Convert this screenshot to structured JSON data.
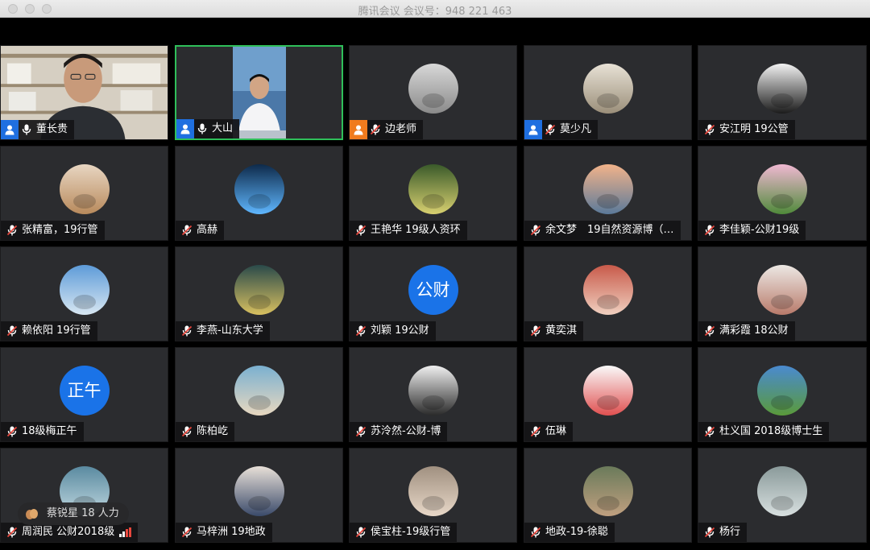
{
  "window": {
    "title": "腾讯会议 会议号：948 221 463"
  },
  "colors": {
    "tile_bg": "#2b2c2f",
    "active_border": "#2fbf5a",
    "host_badge": "#1f6fe0",
    "host_badge_orange": "#f07b1e",
    "avatar_text_bg": "#1a73e8",
    "mute_red": "#e9473d"
  },
  "participants": [
    {
      "name": "董长贵",
      "host": "blue",
      "mic": "on",
      "type": "video-bookshelf"
    },
    {
      "name": "大山",
      "host": "blue",
      "mic": "on",
      "type": "video-speaker",
      "active": true
    },
    {
      "name": "边老师",
      "host": "orange",
      "mic": "muted",
      "type": "avatar",
      "avatar": "road-photo"
    },
    {
      "name": "莫少凡",
      "host": "blue",
      "mic": "muted",
      "type": "avatar",
      "avatar": "wall-photo"
    },
    {
      "name": "安江明 19公管",
      "mic": "muted",
      "type": "avatar",
      "avatar": "hooded-photo"
    },
    {
      "name": "张精富，19行管",
      "mic": "muted",
      "type": "avatar",
      "avatar": "cat-photo"
    },
    {
      "name": "高赫",
      "mic": "muted",
      "type": "avatar",
      "avatar": "energy-photo"
    },
    {
      "name": "王艳华 19级人资环",
      "mic": "muted",
      "type": "avatar",
      "avatar": "tree-photo"
    },
    {
      "name": "余文梦　19自然资源博（…",
      "mic": "muted",
      "type": "avatar",
      "avatar": "sunset-lake-photo"
    },
    {
      "name": "李佳颖-公财19级",
      "mic": "muted",
      "type": "avatar",
      "avatar": "blossom-photo"
    },
    {
      "name": "赖依阳 19行管",
      "mic": "muted",
      "type": "avatar",
      "avatar": "sky-photo"
    },
    {
      "name": "李燕-山东大学",
      "mic": "muted",
      "type": "avatar",
      "avatar": "illustration-photo"
    },
    {
      "name": "刘颖 19公财",
      "mic": "muted",
      "type": "avatar-text",
      "avatar_text": "公财"
    },
    {
      "name": "黄奕淇",
      "mic": "muted",
      "type": "avatar",
      "avatar": "church-photo"
    },
    {
      "name": "满彩霞 18公财",
      "mic": "muted",
      "type": "avatar",
      "avatar": "building-photo"
    },
    {
      "name": "18级梅正午",
      "mic": "muted",
      "type": "avatar-text",
      "avatar_text": "正午"
    },
    {
      "name": "陈柏屹",
      "mic": "muted",
      "type": "avatar",
      "avatar": "sea-photo"
    },
    {
      "name": "苏泠然-公财-博",
      "mic": "muted",
      "type": "avatar",
      "avatar": "portrait-photo"
    },
    {
      "name": "伍琳",
      "mic": "muted",
      "type": "avatar",
      "avatar": "cartoon-photo"
    },
    {
      "name": "杜义国 2018级博士生",
      "mic": "muted",
      "type": "avatar",
      "avatar": "field-photo"
    },
    {
      "name": "周润民 公财2018级",
      "mic": "muted",
      "type": "avatar",
      "avatar": "lake-photo",
      "signal": true
    },
    {
      "name": "马梓洲 19地政",
      "mic": "muted",
      "type": "avatar",
      "avatar": "basketball-photo"
    },
    {
      "name": "侯宝柱-19级行管",
      "mic": "muted",
      "type": "avatar",
      "avatar": "family-photo"
    },
    {
      "name": "地政-19-徐聪",
      "mic": "muted",
      "type": "avatar",
      "avatar": "people-photo"
    },
    {
      "name": "杨行",
      "mic": "muted",
      "type": "avatar",
      "avatar": "landscape-photo"
    }
  ],
  "raise_hand": {
    "text": "蔡锐星 18 人力",
    "icon": "clap-hands-icon"
  }
}
